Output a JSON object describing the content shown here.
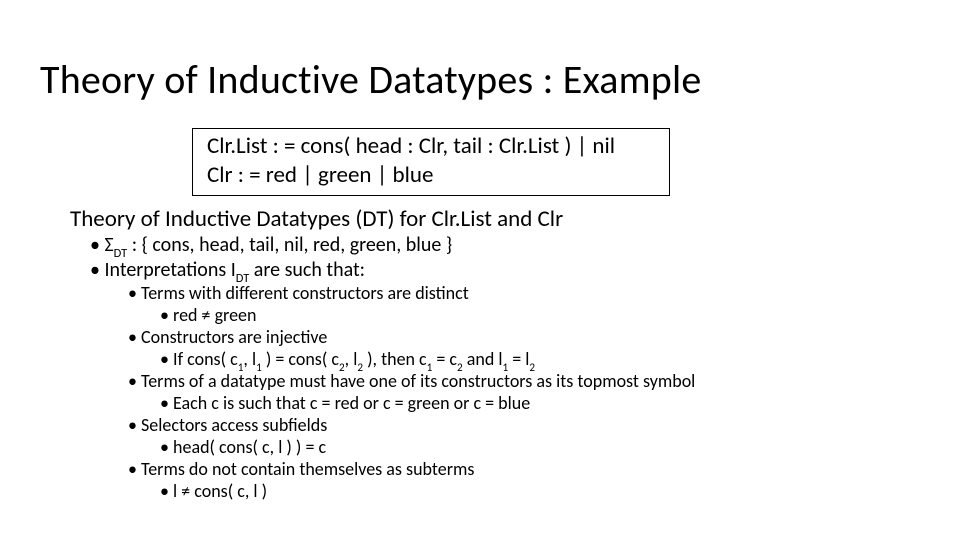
{
  "title": "Theory of Inductive Datatypes : Example",
  "defbox": {
    "line1": "Clr.List : = cons( head : Clr, tail : Clr.List ) | nil",
    "line2": "Clr : = red | green | blue"
  },
  "section_heading": "Theory of Inductive Datatypes (DT) for Clr.List and Clr",
  "sigma_bullet": {
    "prefix": "• Σ",
    "sub": "DT",
    "suffix": " : { cons, head, tail, nil, red, green, blue }"
  },
  "interp_bullet": {
    "prefix": "• Interpretations I",
    "sub": "DT",
    "suffix": " are such that:"
  },
  "p1": {
    "head": "• Terms with different constructors are distinct",
    "sub": "• red ≠ green"
  },
  "p2": {
    "head": "• Constructors are injective",
    "sub_prefix": "• If cons( c",
    "s1": "1",
    "m1": ", l",
    "s2": "1",
    "m2": " ) = cons( c",
    "s3": "2",
    "m3": ", l",
    "s4": "2",
    "m4": " ), then c",
    "s5": "1",
    "m5": " = c",
    "s6": "2",
    "m6": " and l",
    "s7": "1",
    "m7": " = l",
    "s8": "2"
  },
  "p3": {
    "head": "• Terms of a datatype must have one of its constructors as its topmost symbol",
    "sub": "• Each c is such that c = red or c = green or c = blue"
  },
  "p4": {
    "head": "• Selectors access subfields",
    "sub": "• head( cons( c, l ) ) = c"
  },
  "p5": {
    "head": "• Terms do not contain themselves as subterms",
    "sub": "• l ≠ cons( c, l )"
  }
}
